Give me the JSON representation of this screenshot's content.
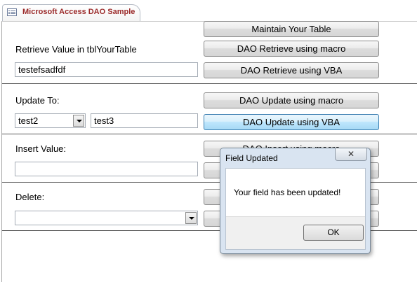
{
  "tab": {
    "title": "Microsoft Access DAO Sample",
    "icon": "form-icon"
  },
  "buttons": {
    "maintain": "Maintain Your Table",
    "retrieve_macro": "DAO Retrieve using macro",
    "retrieve_vba": "DAO Retrieve using VBA",
    "update_macro": "DAO Update using macro",
    "update_vba": "DAO Update using VBA",
    "insert_macro": "DAO Insert using macro"
  },
  "retrieve": {
    "label": "Retrieve Value in tblYourTable",
    "value": "testefsadfdf"
  },
  "update": {
    "label": "Update To:",
    "combo_value": "test2",
    "text_value": "test3"
  },
  "insert": {
    "label": "Insert Value:",
    "value": ""
  },
  "delete": {
    "label": "Delete:",
    "combo_value": ""
  },
  "dialog": {
    "title": "Field Updated",
    "close_glyph": "✕",
    "message": "Your field has been updated!",
    "ok_label": "OK"
  }
}
